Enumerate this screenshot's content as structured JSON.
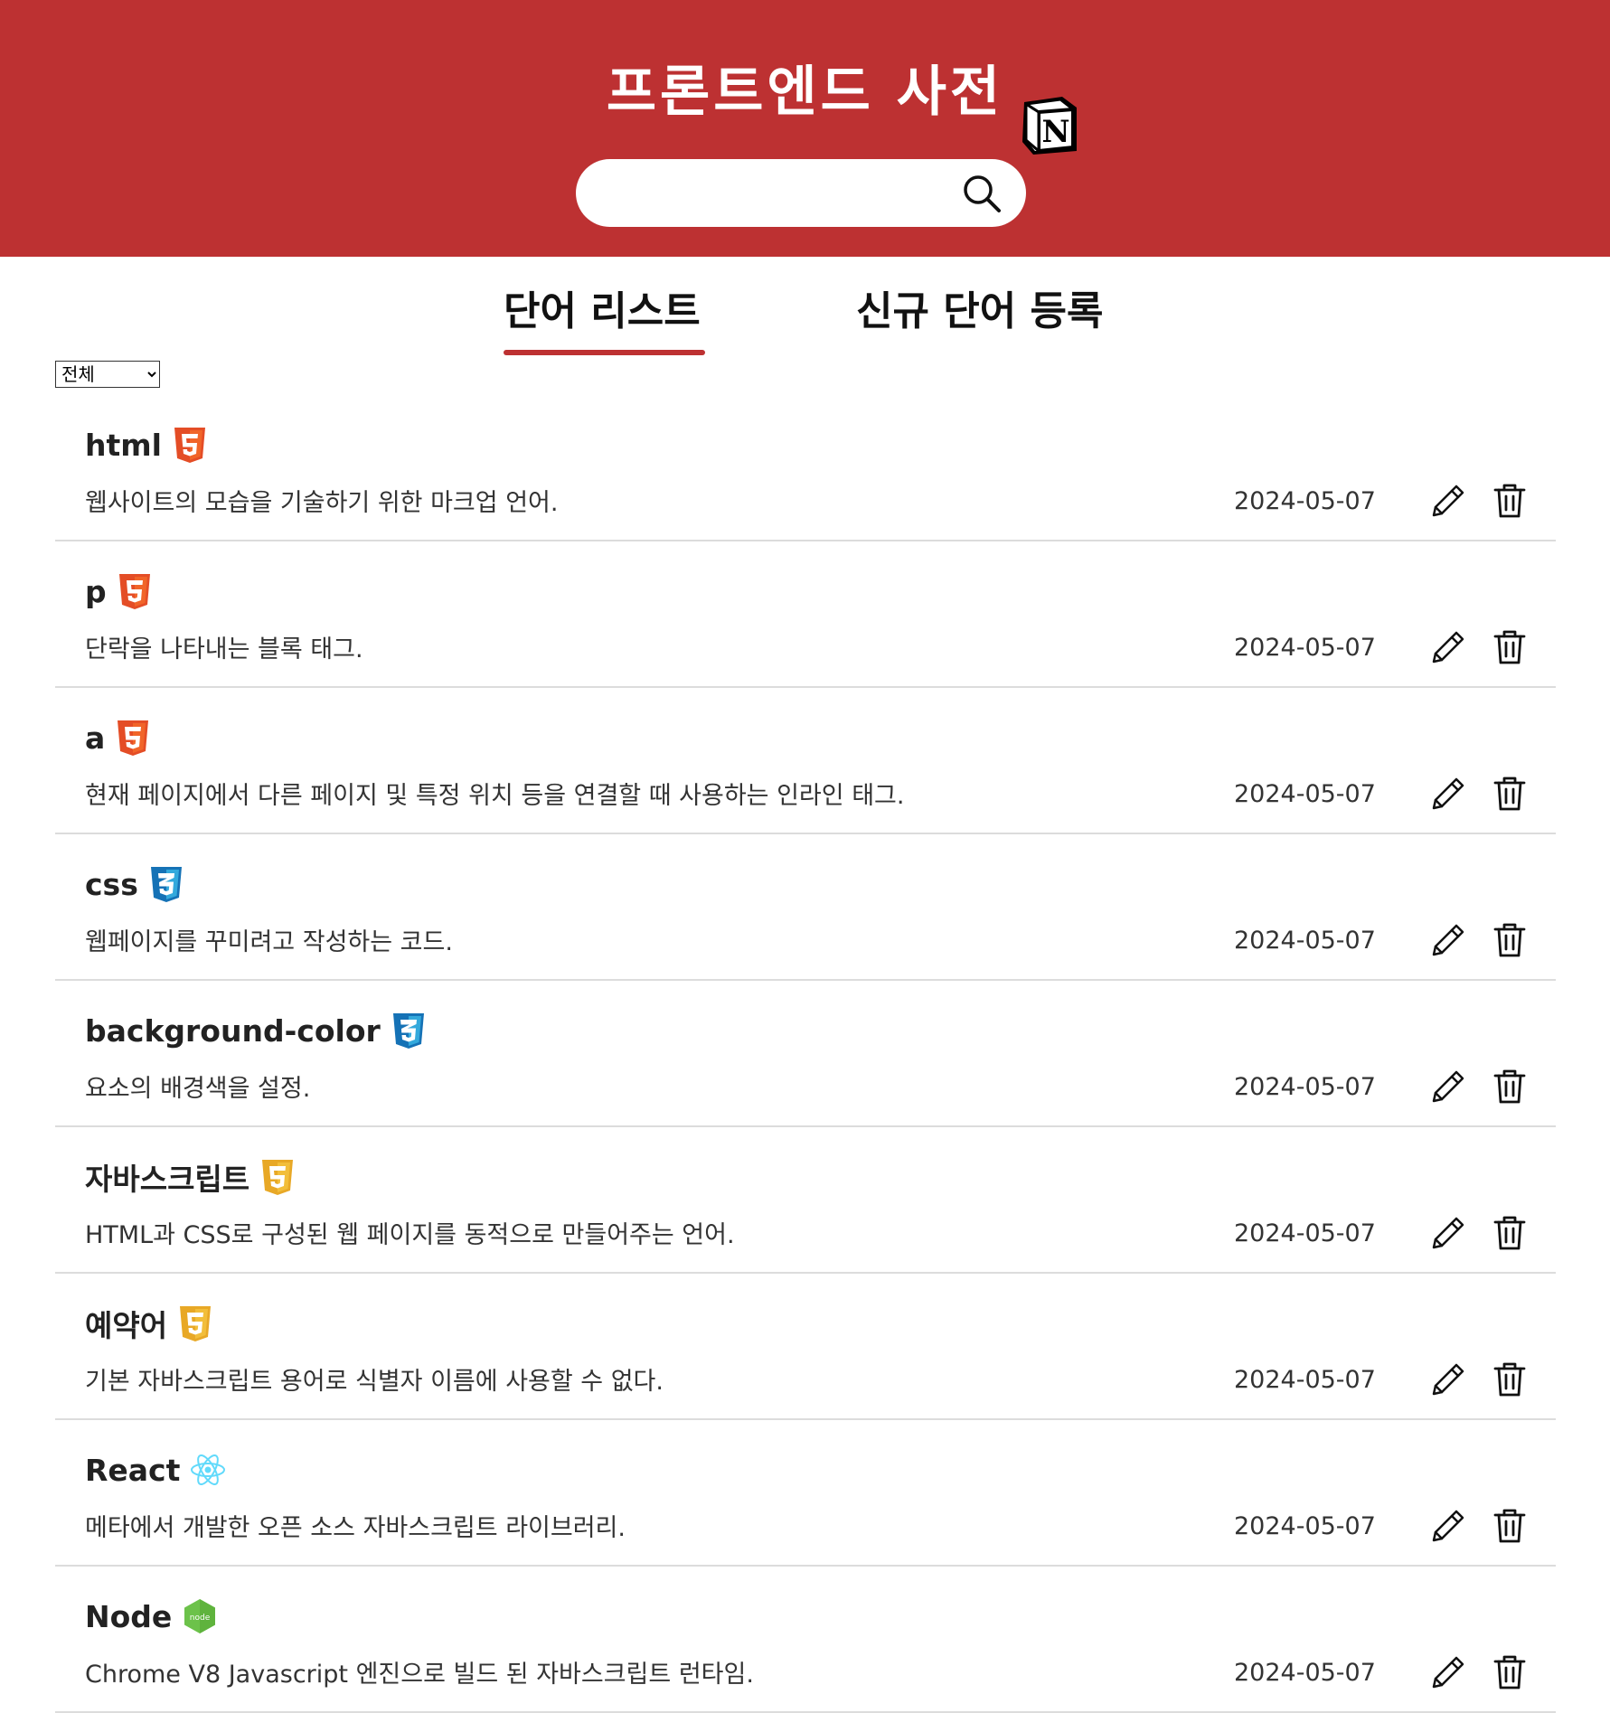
{
  "header": {
    "title": "프론트엔드 사전",
    "logo_icon": "notion-logo",
    "search": {
      "value": "",
      "placeholder": "",
      "icon": "search-icon"
    },
    "background_color": "#bd3132"
  },
  "tabs": [
    {
      "label": "단어 리스트",
      "active": true
    },
    {
      "label": "신규 단어 등록",
      "active": false
    }
  ],
  "filter": {
    "selected": "전체",
    "options": [
      "전체"
    ]
  },
  "words": [
    {
      "name": "html",
      "icon": "html5-icon",
      "description": "웹사이트의 모습을 기술하기 위한 마크업 언어.",
      "date": "2024-05-07"
    },
    {
      "name": "p",
      "icon": "html5-icon",
      "description": "단락을 나타내는 블록 태그.",
      "date": "2024-05-07"
    },
    {
      "name": "a",
      "icon": "html5-icon",
      "description": "현재 페이지에서 다른 페이지 및 특정 위치 등을 연결할 때 사용하는 인라인 태그.",
      "date": "2024-05-07"
    },
    {
      "name": "css",
      "icon": "css3-icon",
      "description": "웹페이지를 꾸미려고 작성하는 코드.",
      "date": "2024-05-07"
    },
    {
      "name": "background-color",
      "icon": "css3-icon",
      "description": "요소의 배경색을 설정.",
      "date": "2024-05-07"
    },
    {
      "name": "자바스크립트",
      "icon": "javascript-icon",
      "description": "HTML과 CSS로 구성된 웹 페이지를 동적으로 만들어주는 언어.",
      "date": "2024-05-07"
    },
    {
      "name": "예약어",
      "icon": "javascript-icon",
      "description": "기본 자바스크립트 용어로 식별자 이름에 사용할 수 없다.",
      "date": "2024-05-07"
    },
    {
      "name": "React",
      "icon": "react-icon",
      "description": "메타에서 개발한 오픈 소스 자바스크립트 라이브러리.",
      "date": "2024-05-07"
    },
    {
      "name": "Node",
      "icon": "nodejs-icon",
      "description": "Chrome V8 Javascript 엔진으로 빌드 된 자바스크립트 런타임.",
      "date": "2024-05-07"
    }
  ],
  "actions": {
    "edit_icon": "pencil-icon",
    "delete_icon": "trash-icon"
  },
  "colors": {
    "accent": "#bd3132",
    "html5": "#e44d26",
    "css3": "#1572b6",
    "javascript": "#e8a826",
    "react": "#61dafb",
    "nodejs": "#6cc24a"
  }
}
